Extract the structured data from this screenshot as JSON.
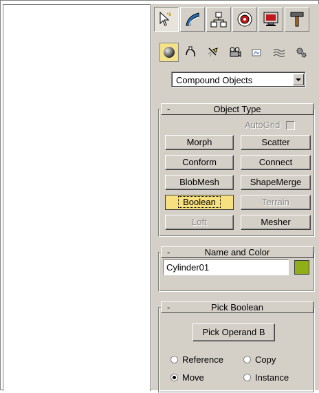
{
  "colors": {
    "panel_bg": "#d4d0c8",
    "active_button": "#f7e07f",
    "object_color": "#8fae18"
  },
  "main_tabs": [
    {
      "icon": "create-cursor-icon"
    },
    {
      "icon": "modify-bend-icon"
    },
    {
      "icon": "hierarchy-icon"
    },
    {
      "icon": "motion-icon"
    },
    {
      "icon": "display-monitor-icon"
    },
    {
      "icon": "utilities-hammer-icon"
    }
  ],
  "sub_tabs": [
    {
      "icon": "geometry-sphere-icon"
    },
    {
      "icon": "shapes-icon"
    },
    {
      "icon": "lights-icon"
    },
    {
      "icon": "cameras-icon"
    },
    {
      "icon": "helpers-icon"
    },
    {
      "icon": "space-warps-icon"
    },
    {
      "icon": "systems-icon"
    }
  ],
  "category_dropdown": {
    "value": "Compound Objects"
  },
  "object_type": {
    "title": "Object Type",
    "collapse": "-",
    "autogrid_label": "AutoGrid",
    "buttons": {
      "morph": "Morph",
      "scatter": "Scatter",
      "conform": "Conform",
      "connect": "Connect",
      "blobmesh": "BlobMesh",
      "shapemerge": "ShapeMerge",
      "boolean": "Boolean",
      "terrain": "Terrain",
      "loft": "Loft",
      "mesher": "Mesher"
    }
  },
  "name_and_color": {
    "title": "Name and Color",
    "collapse": "-",
    "name_value": "Cylinder01"
  },
  "pick_boolean": {
    "title": "Pick Boolean",
    "collapse": "-",
    "pick_button": "Pick Operand B",
    "options": {
      "reference": "Reference",
      "copy": "Copy",
      "move": "Move",
      "instance": "Instance"
    },
    "selected": "Move"
  }
}
